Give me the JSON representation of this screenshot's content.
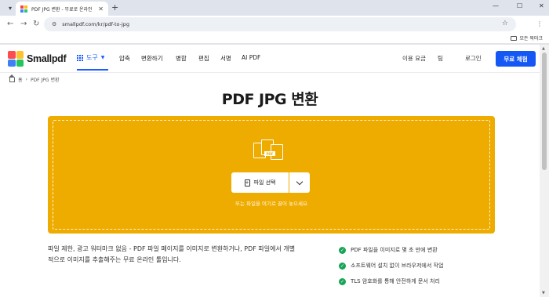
{
  "browser": {
    "tab_title": "PDF JPG 변환 - 무료로 온라인",
    "url": "smallpdf.com/kr/pdf-to-jpg",
    "bookmarks_label": "모든 북마크"
  },
  "site": {
    "brand": "Smallpdf",
    "tools_label": "도구",
    "nav_items": [
      "압축",
      "변환하기",
      "병합",
      "편집",
      "서명",
      "AI PDF"
    ],
    "pricing_label": "이용 요금",
    "team_label": "팀",
    "login_label": "로그인",
    "cta_label": "무료 체험"
  },
  "breadcrumb": {
    "home": "홈",
    "current": "PDF JPG 변환"
  },
  "main": {
    "title": "PDF JPG 변환",
    "choose_file_label": "파일 선택",
    "pdf_badge": "PDF",
    "drop_hint": "또는 파일을 여기로 끌어 놓으세요",
    "description": "파일 제한, 광고 워터마크 없음 - PDF 파일 페이지를 이미지로 변환하거나, PDF 파일에서 개별적으로 이미지를 추출해주는 무료 온라인 툴입니다.",
    "features": [
      "PDF 파일을 이미지로 몇 초 만에 변환",
      "소프트웨어 설치 없이 브라우저에서 작업",
      "TLS 암호화를 통해 안전하게 문서 처리"
    ]
  },
  "colors": {
    "accent": "#1457f5",
    "dropzone": "#efac00",
    "check": "#18a558"
  }
}
